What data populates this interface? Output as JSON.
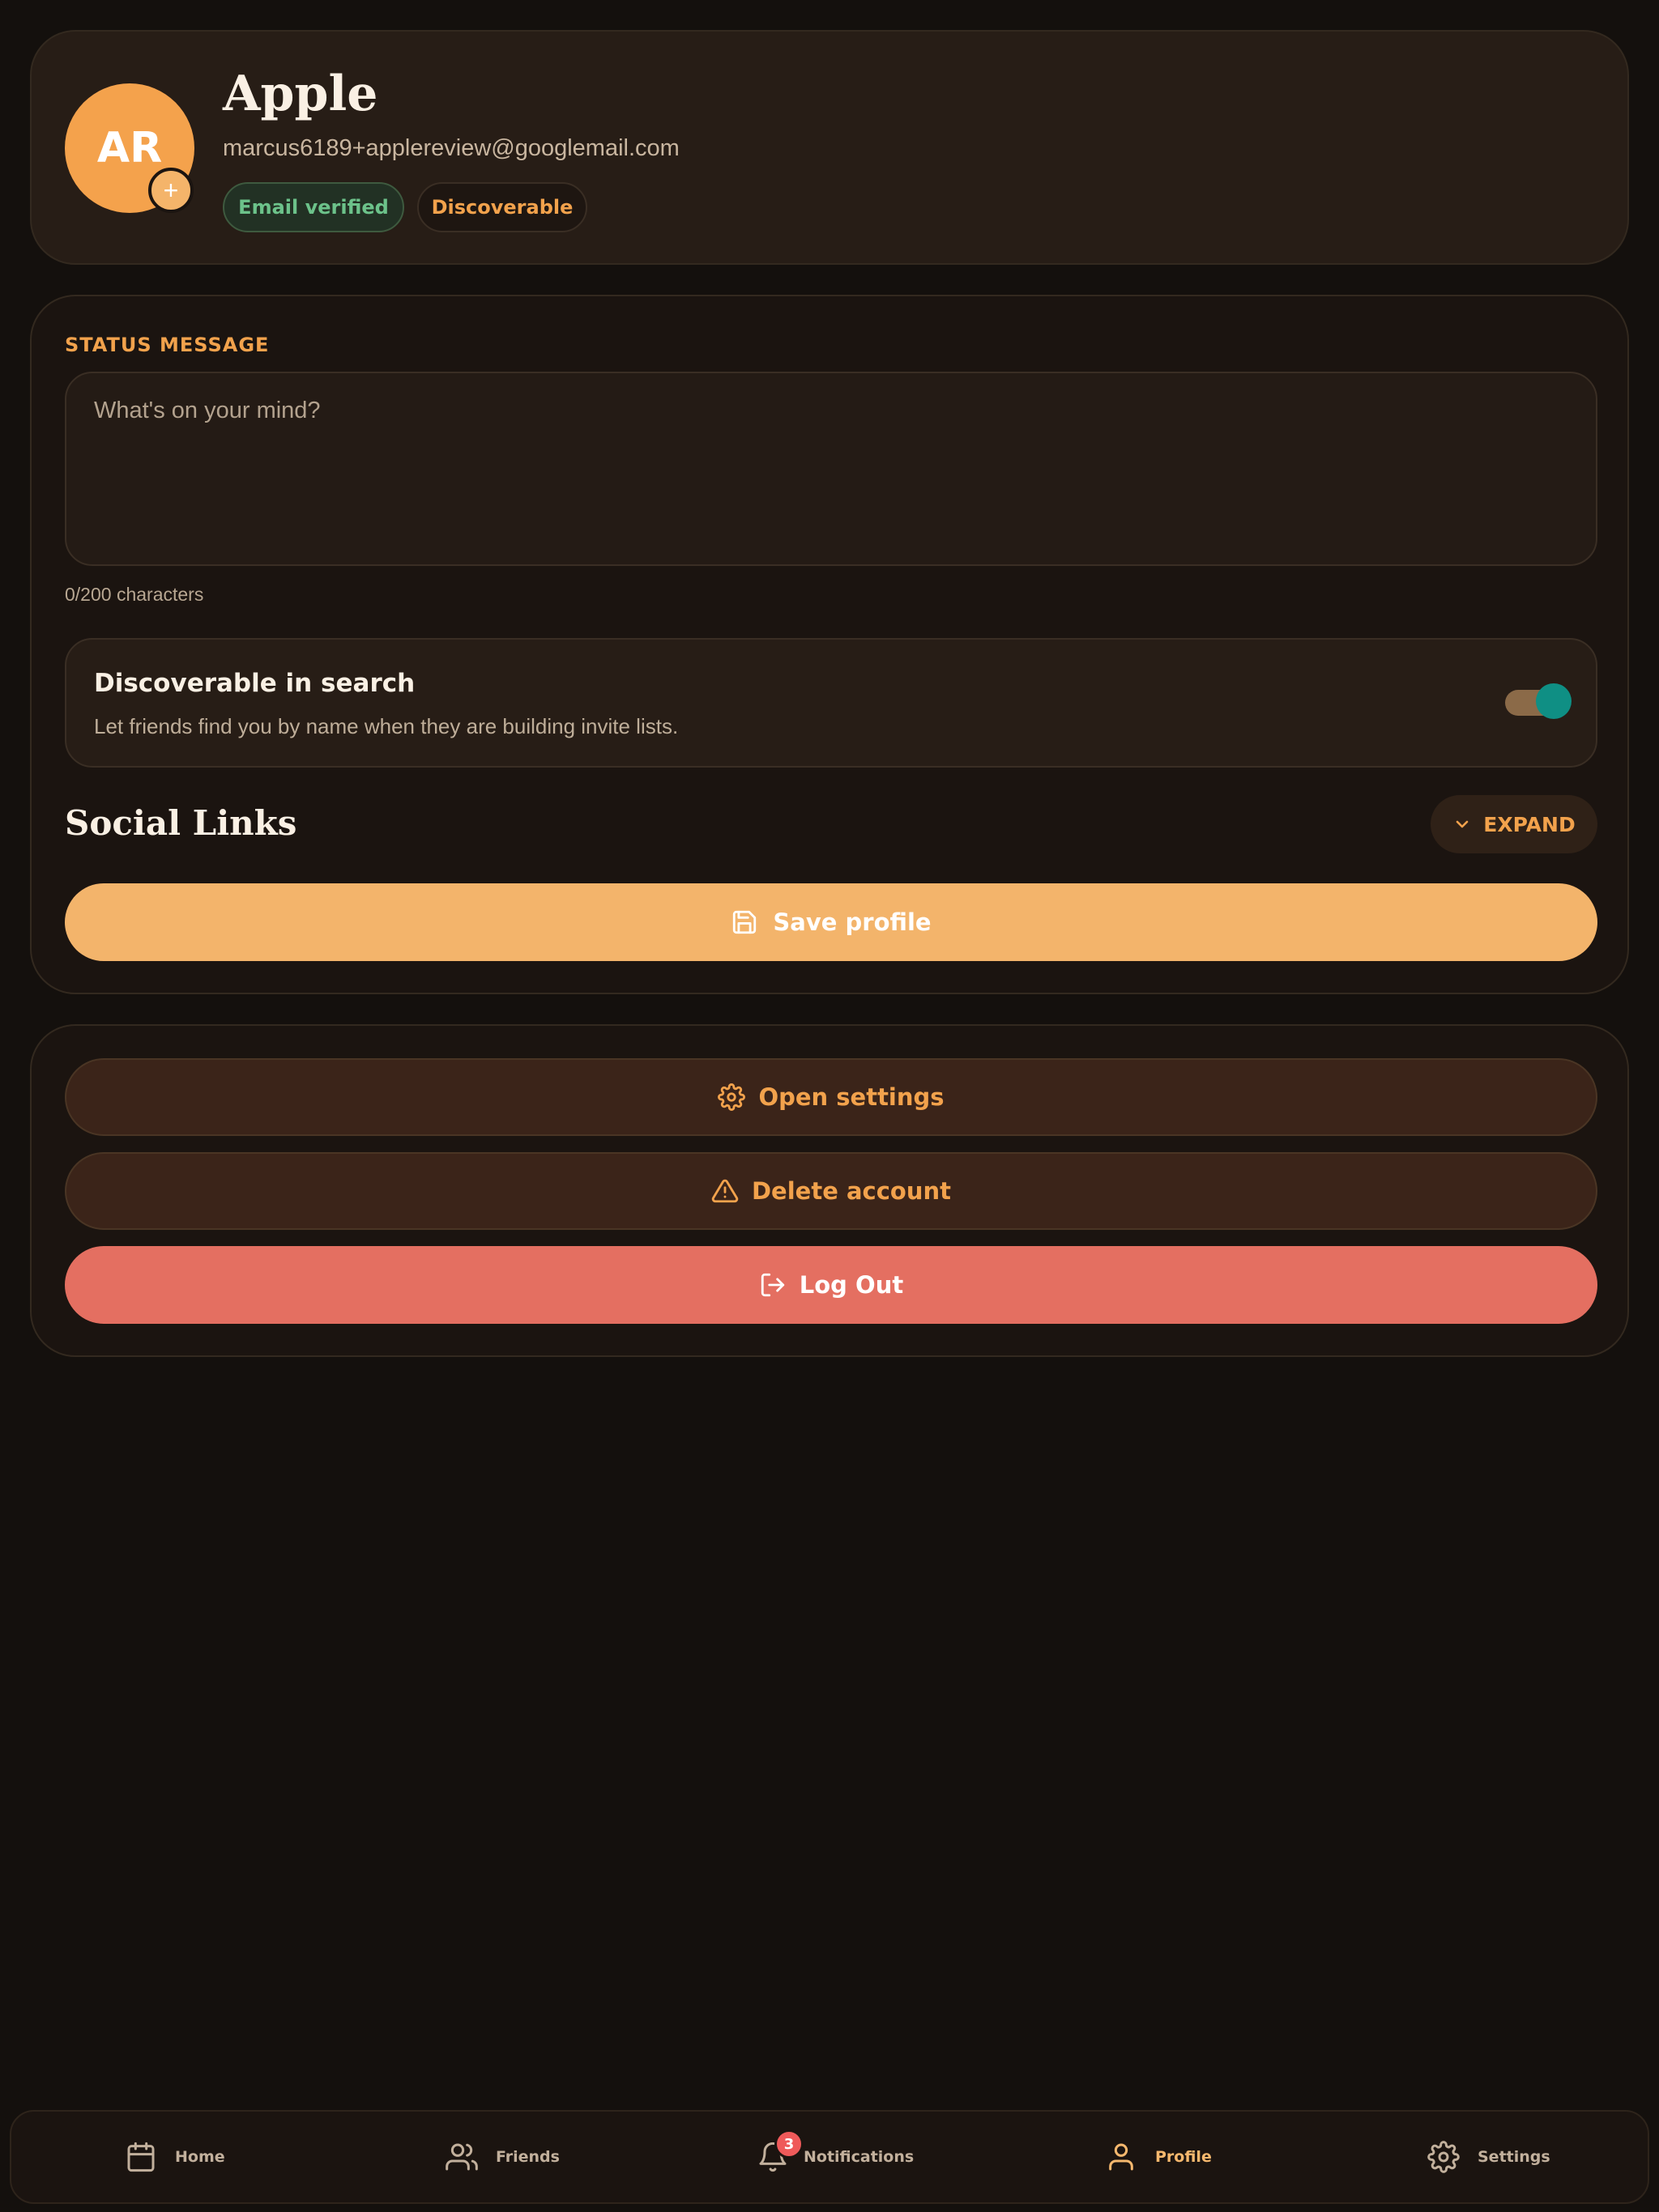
{
  "profile": {
    "initials": "AR",
    "add_photo_icon": "+",
    "name": "Apple",
    "email": "marcus6189+applereview@googlemail.com",
    "badges": {
      "verified": "Email verified",
      "discoverable": "Discoverable"
    }
  },
  "status": {
    "label": "STATUS MESSAGE",
    "placeholder": "What's on your mind?",
    "value": "",
    "char_count": "0/200 characters"
  },
  "discoverable": {
    "title": "Discoverable in search",
    "description": "Let friends find you by name when they are building invite lists.",
    "enabled": true
  },
  "social": {
    "title": "Social Links",
    "expand_label": "EXPAND"
  },
  "save_label": "Save profile",
  "actions": {
    "open_settings": "Open settings",
    "delete_account": "Delete account",
    "log_out": "Log Out"
  },
  "nav": {
    "items": [
      {
        "label": "Home",
        "icon": "calendar-icon"
      },
      {
        "label": "Friends",
        "icon": "users-icon"
      },
      {
        "label": "Notifications",
        "icon": "bell-icon",
        "badge": "3"
      },
      {
        "label": "Profile",
        "icon": "user-icon",
        "active": true
      },
      {
        "label": "Settings",
        "icon": "gear-icon"
      }
    ]
  },
  "colors": {
    "accent": "#f2a24c",
    "background": "#14100d",
    "danger": "#e46f61",
    "verified": "#6cc28a",
    "toggle_on": "#0f8f84"
  }
}
